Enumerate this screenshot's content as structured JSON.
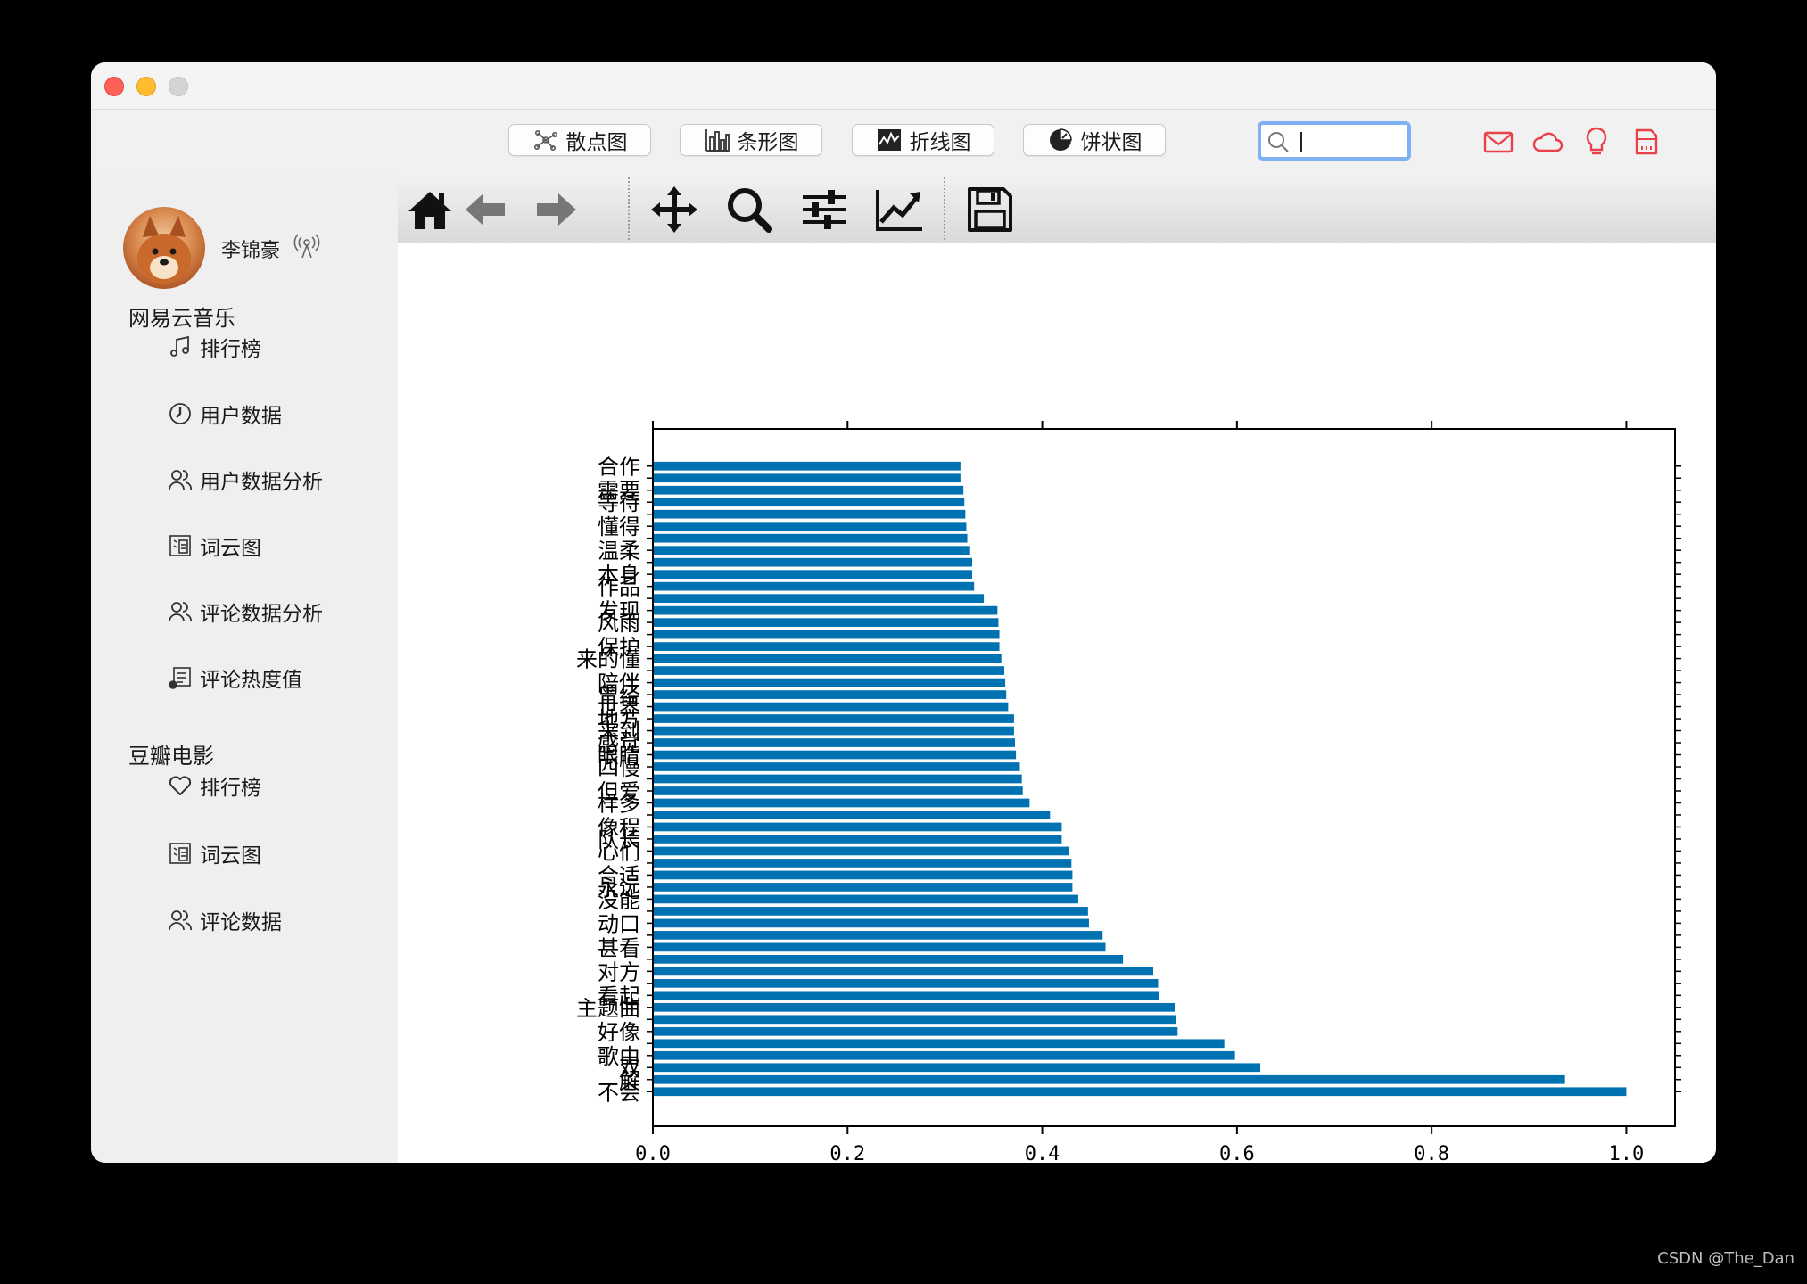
{
  "topbar": {
    "buttons": [
      {
        "label": "散点图",
        "icon": "scatter-icon"
      },
      {
        "label": "条形图",
        "icon": "bar-chart-icon"
      },
      {
        "label": "折线图",
        "icon": "line-chart-icon"
      },
      {
        "label": "饼状图",
        "icon": "pie-chart-icon"
      }
    ],
    "search": {
      "value": ""
    },
    "icons": [
      "mail-icon",
      "cloud-icon",
      "lightbulb-icon",
      "sd-card-icon"
    ],
    "icon_color": "#e8414a"
  },
  "sidebar": {
    "username": "李锦豪",
    "sections": [
      {
        "title": "网易云音乐",
        "items": [
          {
            "label": "排行榜",
            "icon": "music-note-icon"
          },
          {
            "label": "用户数据",
            "icon": "clock-icon"
          },
          {
            "label": "用户数据分析",
            "icon": "users-icon"
          },
          {
            "label": "词云图",
            "icon": "word-cloud-icon"
          },
          {
            "label": "评论数据分析",
            "icon": "users-icon"
          },
          {
            "label": "评论热度值",
            "icon": "comment-heat-icon"
          }
        ]
      },
      {
        "title": "豆瓣电影",
        "items": [
          {
            "label": "排行榜",
            "icon": "heart-icon"
          },
          {
            "label": "词云图",
            "icon": "word-cloud-icon"
          },
          {
            "label": "评论数据",
            "icon": "users-icon"
          }
        ]
      }
    ]
  },
  "mpl_toolbar": {
    "tools": [
      "home-icon",
      "back-icon",
      "forward-icon",
      "pan-icon",
      "zoom-icon",
      "configure-subplots-icon",
      "edit-axes-icon",
      "save-icon"
    ]
  },
  "watermark": "CSDN @The_Dan",
  "chart_data": {
    "type": "bar",
    "orientation": "horizontal",
    "color": "#0072b2",
    "xlim": [
      0.0,
      1.05
    ],
    "xticks": [
      "0.0",
      "0.2",
      "0.4",
      "0.6",
      "0.8",
      "1.0"
    ],
    "xtick_values": [
      0.0,
      0.2,
      0.4,
      0.6,
      0.8,
      1.0
    ],
    "values": [
      1.0,
      0.937,
      0.624,
      0.598,
      0.587,
      0.539,
      0.537,
      0.536,
      0.52,
      0.519,
      0.514,
      0.483,
      0.465,
      0.462,
      0.448,
      0.447,
      0.437,
      0.431,
      0.431,
      0.43,
      0.427,
      0.42,
      0.42,
      0.408,
      0.387,
      0.38,
      0.379,
      0.377,
      0.373,
      0.372,
      0.371,
      0.371,
      0.365,
      0.363,
      0.362,
      0.361,
      0.358,
      0.356,
      0.356,
      0.355,
      0.354,
      0.34,
      0.33,
      0.328,
      0.328,
      0.325,
      0.323,
      0.322,
      0.321,
      0.32,
      0.319,
      0.316,
      0.316
    ],
    "labels": [
      {
        "text": "不",
        "bar": 0
      },
      {
        "text": "会",
        "bar": 0
      },
      {
        "text": "解",
        "bar": 1
      },
      {
        "text": "双",
        "bar": 2
      },
      {
        "text": "歌",
        "bar": 3
      },
      {
        "text": "由",
        "bar": 3
      },
      {
        "text": "好",
        "bar": 5
      },
      {
        "text": "像",
        "bar": 5
      },
      {
        "text": "主",
        "bar": 7
      },
      {
        "text": "题",
        "bar": 7
      },
      {
        "text": "曲",
        "bar": 7
      },
      {
        "text": "看",
        "bar": 8
      },
      {
        "text": "起",
        "bar": 8
      },
      {
        "text": "对",
        "bar": 10
      },
      {
        "text": "方",
        "bar": 10
      },
      {
        "text": "甚",
        "bar": 12
      },
      {
        "text": "看",
        "bar": 12
      },
      {
        "text": "动",
        "bar": 14
      },
      {
        "text": "口",
        "bar": 14
      },
      {
        "text": "没",
        "bar": 16
      },
      {
        "text": "能",
        "bar": 16
      },
      {
        "text": "永",
        "bar": 17
      },
      {
        "text": "远",
        "bar": 17
      },
      {
        "text": "合",
        "bar": 18
      },
      {
        "text": "适",
        "bar": 18
      },
      {
        "text": "心",
        "bar": 20
      },
      {
        "text": "们",
        "bar": 20
      },
      {
        "text": "队",
        "bar": 21
      },
      {
        "text": "长",
        "bar": 21
      },
      {
        "text": "像",
        "bar": 22
      },
      {
        "text": "程",
        "bar": 22
      },
      {
        "text": "样",
        "bar": 24
      },
      {
        "text": "多",
        "bar": 24
      },
      {
        "text": "但",
        "bar": 25
      },
      {
        "text": "爱",
        "bar": 25
      },
      {
        "text": "四",
        "bar": 27
      },
      {
        "text": "慢",
        "bar": 27
      },
      {
        "text": "眼",
        "bar": 28
      },
      {
        "text": "睛",
        "bar": 28
      },
      {
        "text": "感",
        "bar": 29
      },
      {
        "text": "觉",
        "bar": 29
      },
      {
        "text": "来",
        "bar": 30
      },
      {
        "text": "到",
        "bar": 30
      },
      {
        "text": "地",
        "bar": 31
      },
      {
        "text": "方",
        "bar": 31
      },
      {
        "text": "世",
        "bar": 32
      },
      {
        "text": "界",
        "bar": 32
      },
      {
        "text": "曾",
        "bar": 33
      },
      {
        "text": "经",
        "bar": 33
      },
      {
        "text": "陪",
        "bar": 34
      },
      {
        "text": "伴",
        "bar": 34
      },
      {
        "text": "来",
        "bar": 36
      },
      {
        "text": "的",
        "bar": 36
      },
      {
        "text": "懂",
        "bar": 36
      },
      {
        "text": "保",
        "bar": 37
      },
      {
        "text": "护",
        "bar": 37
      },
      {
        "text": "风",
        "bar": 39
      },
      {
        "text": "雨",
        "bar": 39
      },
      {
        "text": "发",
        "bar": 40
      },
      {
        "text": "现",
        "bar": 40
      },
      {
        "text": "作",
        "bar": 42
      },
      {
        "text": "品",
        "bar": 42
      },
      {
        "text": "本",
        "bar": 43
      },
      {
        "text": "身",
        "bar": 43
      },
      {
        "text": "温",
        "bar": 45
      },
      {
        "text": "柔",
        "bar": 45
      },
      {
        "text": "懂",
        "bar": 47
      },
      {
        "text": "得",
        "bar": 47
      },
      {
        "text": "等",
        "bar": 49
      },
      {
        "text": "待",
        "bar": 49
      },
      {
        "text": "需",
        "bar": 50
      },
      {
        "text": "要",
        "bar": 50
      },
      {
        "text": "合",
        "bar": 52
      },
      {
        "text": "作",
        "bar": 52
      }
    ]
  }
}
